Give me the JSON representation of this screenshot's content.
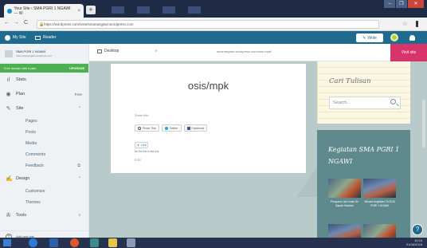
{
  "browser": {
    "tab_title": "Your Site ‹ SMA PGRI 1 NGAWI — W",
    "tab_close": "×",
    "new_tab": "+",
    "url": "https://wordpress.com/view/smanangawi.wordpress.com",
    "back": "←",
    "forward": "→",
    "reload": "C",
    "bookmark_star": "☆",
    "window_controls": [
      "–",
      "❐",
      "✕"
    ]
  },
  "masterbar": {
    "my_site": "My Site",
    "reader": "Reader",
    "write": "Write",
    "brand_color": "#1f6b8f"
  },
  "sidebar": {
    "site_name": "SMA PGRI 1 NGAWI",
    "site_url": "View smanangawi.wordpress.com",
    "upgrade_text": "Free domain with a plan",
    "upgrade_btn": "UPGRADE",
    "items": [
      {
        "label": "Stats",
        "icon": "stats-icon",
        "glyph": "ıl"
      },
      {
        "label": "Plan",
        "icon": "plan-icon",
        "glyph": "◉",
        "meta": "Free"
      },
      {
        "label": "Site",
        "icon": "pencil-icon",
        "glyph": "✎",
        "chev": "^"
      }
    ],
    "site_subitems": [
      "Pages",
      "Posts",
      "Media",
      "Comments",
      "Feedback"
    ],
    "design": {
      "label": "Design",
      "icon": "design-icon",
      "glyph": "✍",
      "chev": "^"
    },
    "design_subitems": [
      "Customize",
      "Themes"
    ],
    "tools": {
      "label": "Tools",
      "icon": "tools-icon",
      "glyph": "✇",
      "chev": "v"
    },
    "add_site": "Add new site",
    "add_site_plus": "+"
  },
  "preview_bar": {
    "device": "Desktop",
    "device_caret": "v",
    "url": "smanangawi.wordpress.com/osis-mpk/",
    "visit_site": "Visit site",
    "visit_color": "#d8336a"
  },
  "post": {
    "title": "osis/mpk",
    "share_label": "Share this:",
    "share_buttons": [
      "Press This",
      "Twitter",
      "Facebook"
    ],
    "like_label": "Like",
    "like_first": "Be the first to like this.",
    "edit": "Edit"
  },
  "widgets": {
    "search_title": "Cari Tulisan",
    "search_placeholder": "Search...",
    "news_title": "Kegiatan SMA PGRI 1 NGAWI",
    "captions": [
      "Pengurus Lab Lintas Se Bapak Sekolah",
      "Wisuda Angkatan TA 2016 PGRI 1 NGAWI"
    ]
  },
  "help_label": "?",
  "taskbar": {
    "time": "10:18",
    "date": "01/06/2018"
  }
}
